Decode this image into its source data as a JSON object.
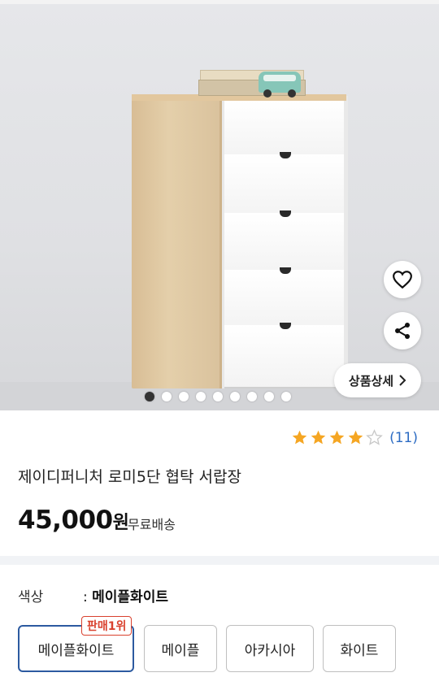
{
  "product": {
    "image_dots_total": 9,
    "image_dot_active_index": 0,
    "detail_button_label": "상품상세",
    "rating": {
      "stars": 4,
      "max_stars": 5,
      "review_count": "(11)"
    },
    "title": "제이디퍼니처 로미5단 협탁 서랍장",
    "price": "45,000",
    "price_unit": "원",
    "shipping": "무료배송"
  },
  "options": {
    "label": "색상",
    "separator": ":",
    "selected_value": "메이플화이트",
    "best_badge": "판매1위",
    "choices": [
      "메이플화이트",
      "메이플",
      "아카시아",
      "화이트"
    ]
  },
  "colors": {
    "accent": "#2c5aa0",
    "badge": "#d9412e",
    "star": "#f5a623",
    "link": "#2d6cc3"
  },
  "icons": {
    "wishlist": "heart-icon",
    "share": "share-icon",
    "detail_arrow": "chevron-right-icon"
  }
}
